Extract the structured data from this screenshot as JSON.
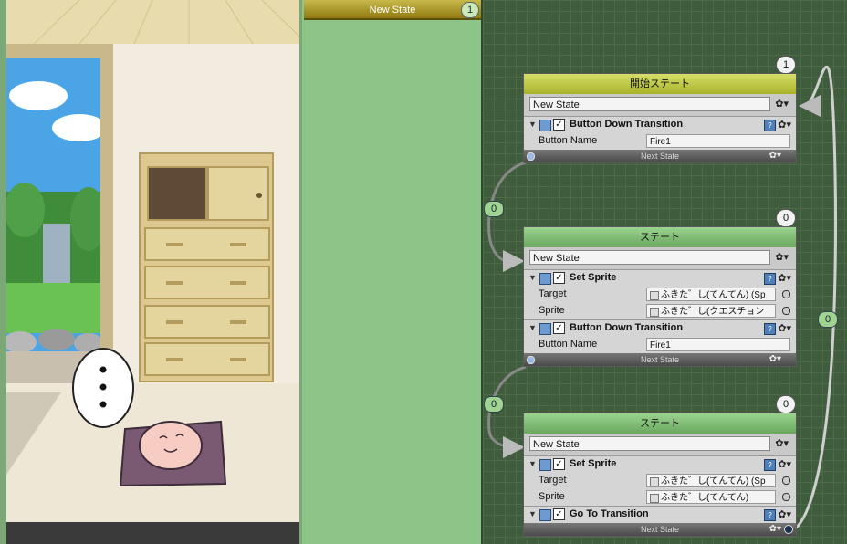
{
  "state_list": {
    "items": [
      {
        "label": "New State",
        "count": "1"
      }
    ]
  },
  "nodes": [
    {
      "count": "1",
      "title": "開始ステート",
      "kind": "start",
      "name": "New State",
      "components": [
        {
          "title": "Button Down Transition",
          "props": [
            {
              "label": "Button Name",
              "value": "Fire1"
            }
          ]
        }
      ],
      "next_label": "Next State"
    },
    {
      "count": "0",
      "title": "ステート",
      "kind": "normal",
      "name": "New State",
      "components": [
        {
          "title": "Set Sprite",
          "props": [
            {
              "label": "Target",
              "value": "ふきた゛し(てんてん) (Sp"
            },
            {
              "label": "Sprite",
              "value": "ふきた゛し(クエスチョン"
            }
          ]
        },
        {
          "title": "Button Down Transition",
          "props": [
            {
              "label": "Button Name",
              "value": "Fire1"
            }
          ]
        }
      ],
      "next_label": "Next State"
    },
    {
      "count": "0",
      "title": "ステート",
      "kind": "normal",
      "name": "New State",
      "components": [
        {
          "title": "Set Sprite",
          "props": [
            {
              "label": "Target",
              "value": "ふきた゛し(てんてん) (Sp"
            },
            {
              "label": "Sprite",
              "value": "ふきた゛し(てんてん)"
            }
          ]
        },
        {
          "title": "Go To Transition",
          "props": []
        }
      ],
      "next_label": "Next State"
    }
  ],
  "wires": [
    {
      "count": "0"
    },
    {
      "count": "0"
    },
    {
      "count": "0"
    }
  ],
  "icons": {
    "gear": "gear-icon",
    "help": "help-icon",
    "foldout": "triangle-down-icon"
  },
  "colors": {
    "start_header": "#b8c23a",
    "state_header": "#7dbb71",
    "list_item": "#a8951c",
    "canvas": "#3f5d3c"
  }
}
